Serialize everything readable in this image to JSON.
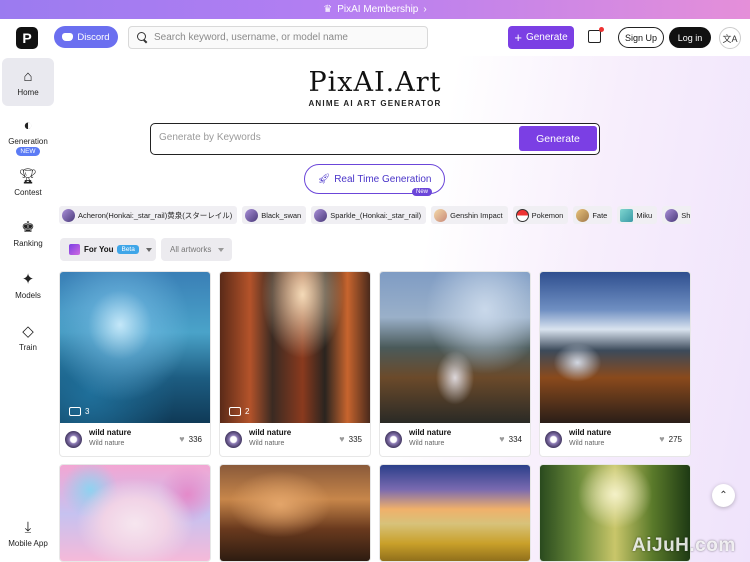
{
  "banner": {
    "text": "PixAI Membership"
  },
  "header": {
    "discord_label": "Discord",
    "search_placeholder": "Search keyword, username, or model name",
    "generate_label": "Generate",
    "signup_label": "Sign Up",
    "login_label": "Log in"
  },
  "sidebar": {
    "items": [
      {
        "label": "Home"
      },
      {
        "label": "Generation",
        "badge": "NEW"
      },
      {
        "label": "Contest"
      },
      {
        "label": "Ranking"
      },
      {
        "label": "Models"
      },
      {
        "label": "Train"
      },
      {
        "label": "Mobile App"
      }
    ]
  },
  "hero": {
    "title": "PixAI.Art",
    "subtitle": "ANIME AI ART GENERATOR",
    "input_placeholder": "Generate by Keywords",
    "generate_label": "Generate",
    "realtime_label": "Real Time Generation",
    "realtime_badge": "New"
  },
  "tags": [
    "Acheron(Honkai:_star_rail)黄泉(スターレイル)",
    "Black_swan",
    "Sparkle_(Honkai:_star_rail)",
    "Genshin Impact",
    "Pokemon",
    "Fate",
    "Miku",
    "Sh"
  ],
  "filters": {
    "for_you": "For You",
    "beta": "Beta",
    "all_artworks": "All artworks"
  },
  "cards": [
    {
      "title": "wild nature",
      "subtitle": "Wild nature",
      "likes": "336",
      "comments": "3"
    },
    {
      "title": "wild nature",
      "subtitle": "Wild nature",
      "likes": "335",
      "comments": "2"
    },
    {
      "title": "wild nature",
      "subtitle": "Wild nature",
      "likes": "334"
    },
    {
      "title": "wild nature",
      "subtitle": "Wild nature",
      "likes": "275"
    }
  ],
  "watermark": "AiJuH.com"
}
